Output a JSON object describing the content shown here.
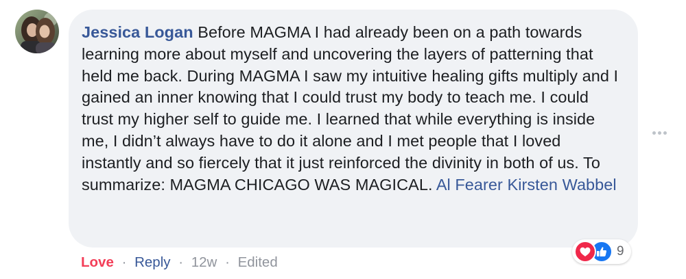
{
  "comment": {
    "author": "Jessica Logan",
    "text": "Before MAGMA I had already been on a path towards learning more about myself and uncovering the layers of patterning that held me back. During MAGMA I saw my intuitive healing gifts multiply and I gained an inner knowing that I could trust my body to teach me. I could trust my higher self to guide me. I learned that while everything is inside me, I didn’t always have to do it alone and I met people that I loved instantly and so fiercely that it just reinforced the divinity in both of us. To summarize: MAGMA CHICAGO WAS MAGICAL.",
    "tags": [
      "Al Fearer",
      "Kirsten Wabbel"
    ]
  },
  "reactions": {
    "icons": [
      "heart-icon",
      "thumbs-up-icon"
    ],
    "count": "9",
    "colors": {
      "love": "#f0284a",
      "like": "#1877f2"
    }
  },
  "actions": {
    "love_label": "Love",
    "reply_label": "Reply",
    "time": "12w",
    "edited_label": "Edited",
    "separator": "·"
  },
  "icons": {
    "more": "more-options-icon",
    "avatar": "avatar"
  },
  "colors": {
    "bubble": "#f0f2f5",
    "link": "#385898",
    "love": "#f33e58",
    "meta": "#90949c"
  }
}
